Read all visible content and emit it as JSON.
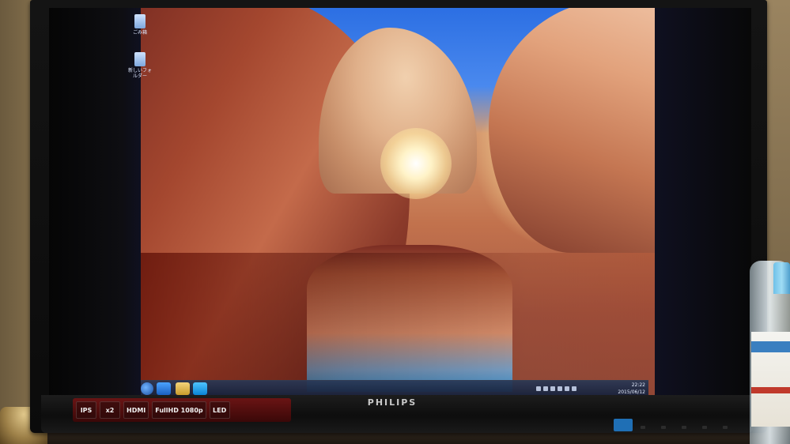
{
  "monitor": {
    "brand": "PHILIPS",
    "stickers": [
      "IPS",
      "x2",
      "HDMI",
      "FullHD 1080p",
      "LED"
    ]
  },
  "desktop": {
    "icons": [
      {
        "label": "ごみ箱",
        "icon": "recycle-bin-icon"
      },
      {
        "label": "新しいフォルダー",
        "icon": "folder-icon"
      }
    ]
  },
  "taskbar": {
    "buttons": [
      {
        "name": "start",
        "icon": "windows-start-icon"
      },
      {
        "name": "internet-explorer",
        "icon": "ie-icon"
      },
      {
        "name": "file-explorer",
        "icon": "folder-icon"
      },
      {
        "name": "skype",
        "icon": "skype-icon"
      }
    ],
    "clock_time": "22:22",
    "clock_date": "2015/06/12"
  },
  "colors": {
    "sky": "#2c6fe3",
    "rock": "#a4472f",
    "bezel": "#111111",
    "sticker_red": "#6a1414"
  }
}
